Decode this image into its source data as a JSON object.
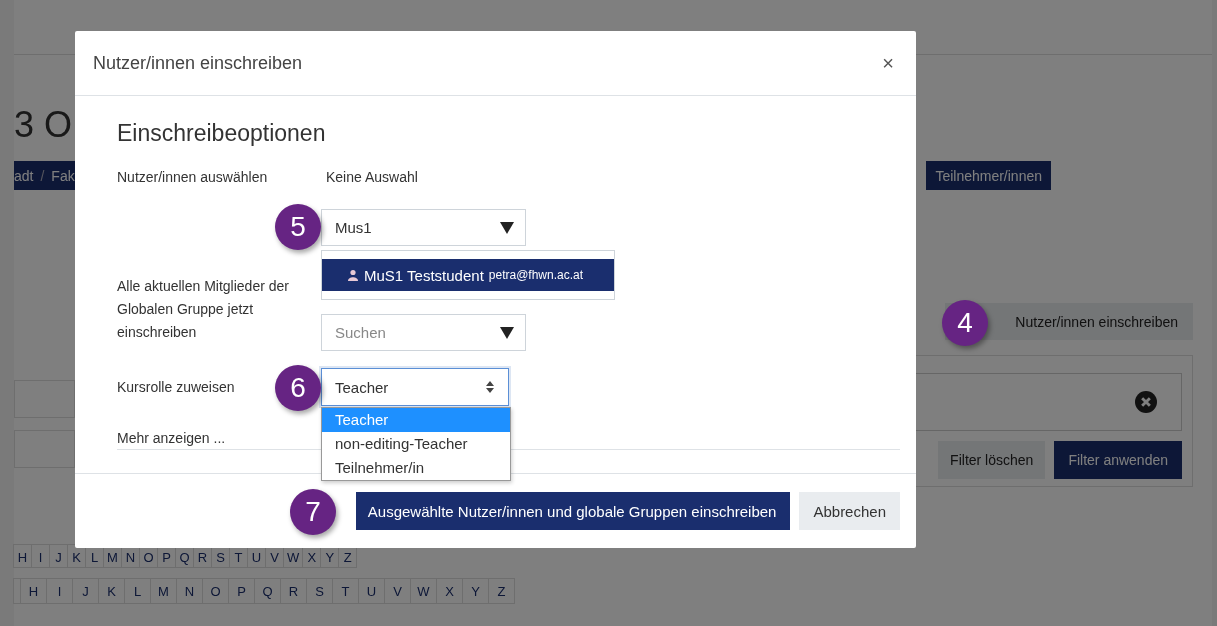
{
  "page": {
    "title_fragment": "3 O",
    "breadcrumb": {
      "items": [
        "adt",
        "Fak"
      ],
      "separator": "/"
    },
    "participants_button": "Teilnehmer/innen",
    "enrol_button": "Nutzer/innen einschreiben",
    "filter_clear": "Filter löschen",
    "filter_apply": "Filter anwenden",
    "letter_rows": [
      [
        "H",
        "I",
        "J",
        "K",
        "L",
        "M",
        "N",
        "O",
        "P",
        "Q",
        "R",
        "S",
        "T",
        "U",
        "V",
        "W",
        "X",
        "Y",
        "Z"
      ],
      [
        "H",
        "I",
        "J",
        "K",
        "L",
        "M",
        "N",
        "O",
        "P",
        "Q",
        "R",
        "S",
        "T",
        "U",
        "V",
        "W",
        "X",
        "Y",
        "Z"
      ]
    ]
  },
  "modal": {
    "title": "Nutzer/innen einschreiben",
    "close": "×",
    "heading": "Einschreibeoptionen",
    "user_select": {
      "label": "Nutzer/innen auswählen",
      "selection": "Keine Auswahl",
      "value": "Mus1",
      "suggestions": [
        {
          "name": "MuS1 Teststudent",
          "email": "petra@fhwn.ac.at",
          "selected": true
        }
      ]
    },
    "group_select": {
      "label": "Alle aktuellen Mitglieder der Globalen Gruppe jetzt einschreiben",
      "placeholder": "Suchen"
    },
    "role_select": {
      "label": "Kursrolle zuweisen",
      "value": "Teacher",
      "expanded": true,
      "options": [
        {
          "label": "Teacher",
          "selected": true
        },
        {
          "label": "non-editing-Teacher",
          "selected": false
        },
        {
          "label": "Teilnehmer/in",
          "selected": false
        }
      ]
    },
    "more_link": "Mehr anzeigen ...",
    "primary_button": "Ausgewählte Nutzer/innen und globale Gruppen einschreiben",
    "cancel_button": "Abbrechen"
  },
  "badges": [
    {
      "label": "5"
    },
    {
      "label": "6"
    },
    {
      "label": "7"
    },
    {
      "label": "4"
    }
  ]
}
